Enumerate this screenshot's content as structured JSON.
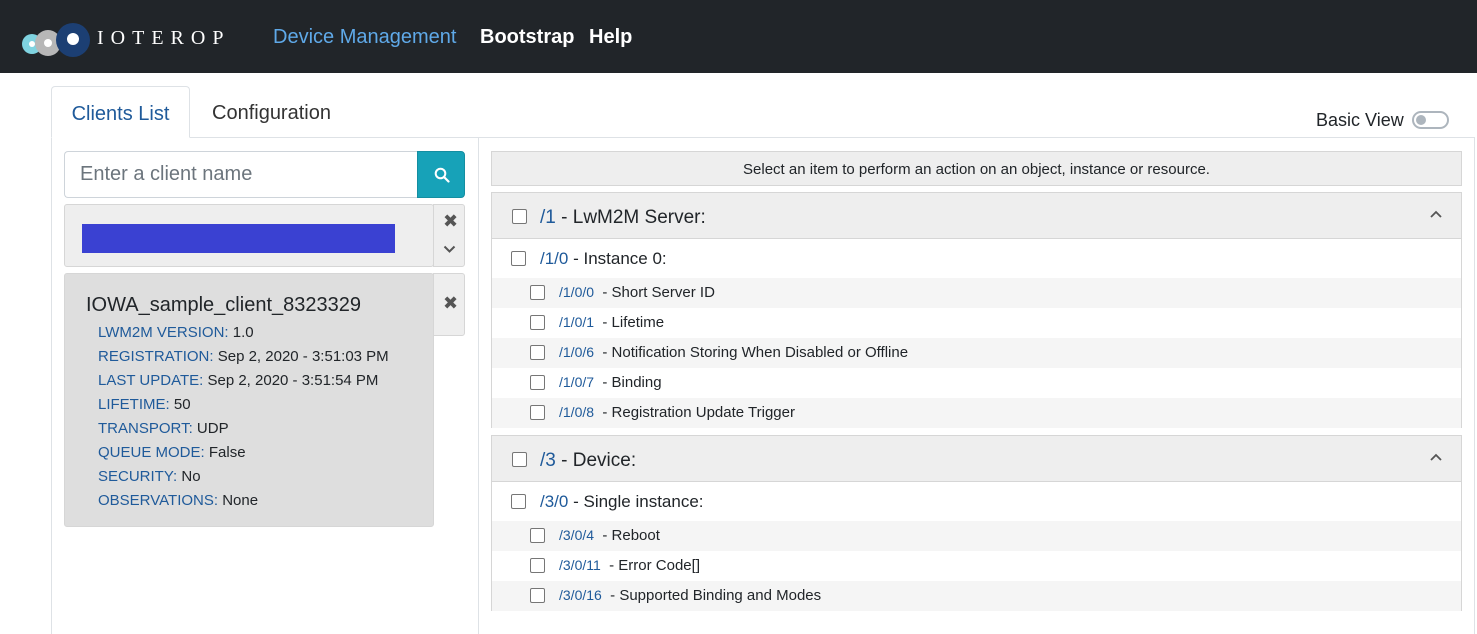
{
  "brand": {
    "name": "IOTEROP"
  },
  "nav": {
    "items": [
      "Device Management",
      "Bootstrap",
      "Help"
    ]
  },
  "tabs": [
    "Clients List",
    "Configuration"
  ],
  "basic_view": {
    "label": "Basic View",
    "enabled": false
  },
  "search": {
    "placeholder": "Enter a client name",
    "value": ""
  },
  "client": {
    "name": "IOWA_sample_client_8323329",
    "fields": [
      {
        "key": "LWM2M VERSION:",
        "value": "1.0"
      },
      {
        "key": "REGISTRATION:",
        "value": "Sep 2, 2020 - 3:51:03 PM"
      },
      {
        "key": "LAST UPDATE:",
        "value": "Sep 2, 2020 - 3:51:54 PM"
      },
      {
        "key": "LIFETIME:",
        "value": "50"
      },
      {
        "key": "TRANSPORT:",
        "value": "UDP"
      },
      {
        "key": "QUEUE MODE:",
        "value": "False"
      },
      {
        "key": "SECURITY:",
        "value": "No"
      },
      {
        "key": "OBSERVATIONS:",
        "value": "None"
      }
    ]
  },
  "hint": "Select an item to perform an action on an object, instance or resource.",
  "objects": [
    {
      "path": "/1",
      "name": "- LwM2M Server:",
      "instance": {
        "path": "/1/0",
        "name": "- Instance 0:"
      },
      "resources": [
        {
          "path": "/1/0/0",
          "name": "- Short Server ID"
        },
        {
          "path": "/1/0/1",
          "name": "- Lifetime"
        },
        {
          "path": "/1/0/6",
          "name": "- Notification Storing When Disabled or Offline"
        },
        {
          "path": "/1/0/7",
          "name": "- Binding"
        },
        {
          "path": "/1/0/8",
          "name": "- Registration Update Trigger"
        }
      ]
    },
    {
      "path": "/3",
      "name": "- Device:",
      "instance": {
        "path": "/3/0",
        "name": "- Single instance:"
      },
      "resources": [
        {
          "path": "/3/0/4",
          "name": "- Reboot"
        },
        {
          "path": "/3/0/11",
          "name": "- Error Code[]"
        },
        {
          "path": "/3/0/16",
          "name": "- Supported Binding and Modes"
        }
      ]
    }
  ],
  "colors": {
    "navbar": "#212529",
    "accent_link": "#5fa9e8",
    "path_blue": "#1f5a9a",
    "search_button": "#17a2b8",
    "client_bar": "#3a41d2"
  }
}
